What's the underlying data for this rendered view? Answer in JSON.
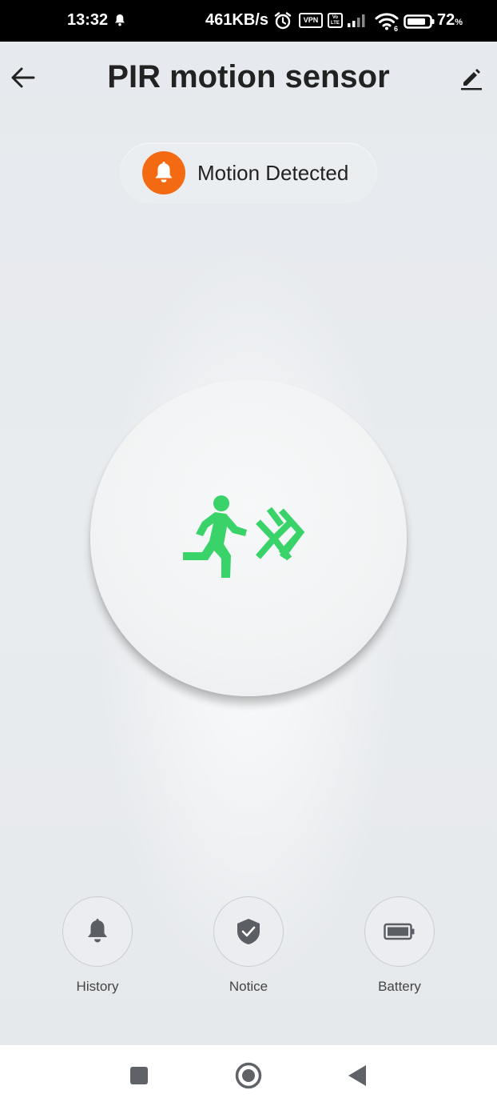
{
  "status_bar": {
    "time": "13:32",
    "speed": "461KB/s",
    "vpn": "VPN",
    "volte": "Vo LTE",
    "battery_percent": "72",
    "battery_percent_sign": "%",
    "icons": [
      "bell-icon",
      "alarm-icon",
      "signal-icon",
      "wifi-icon",
      "battery-icon"
    ]
  },
  "header": {
    "title": "PIR motion sensor",
    "back_icon": "arrow-left-icon",
    "edit_icon": "pencil-icon"
  },
  "status": {
    "text": "Motion Detected",
    "icon": "bell-icon",
    "color": "#f36a13"
  },
  "sensor": {
    "icon": "running-person-motion-icon",
    "color": "#3ad36a"
  },
  "actions": [
    {
      "label": "History",
      "icon": "bell-icon"
    },
    {
      "label": "Notice",
      "icon": "shield-check-icon"
    },
    {
      "label": "Battery",
      "icon": "battery-icon"
    }
  ],
  "nav": {
    "icons": [
      "recents-square-icon",
      "home-circle-icon",
      "back-triangle-icon"
    ]
  }
}
